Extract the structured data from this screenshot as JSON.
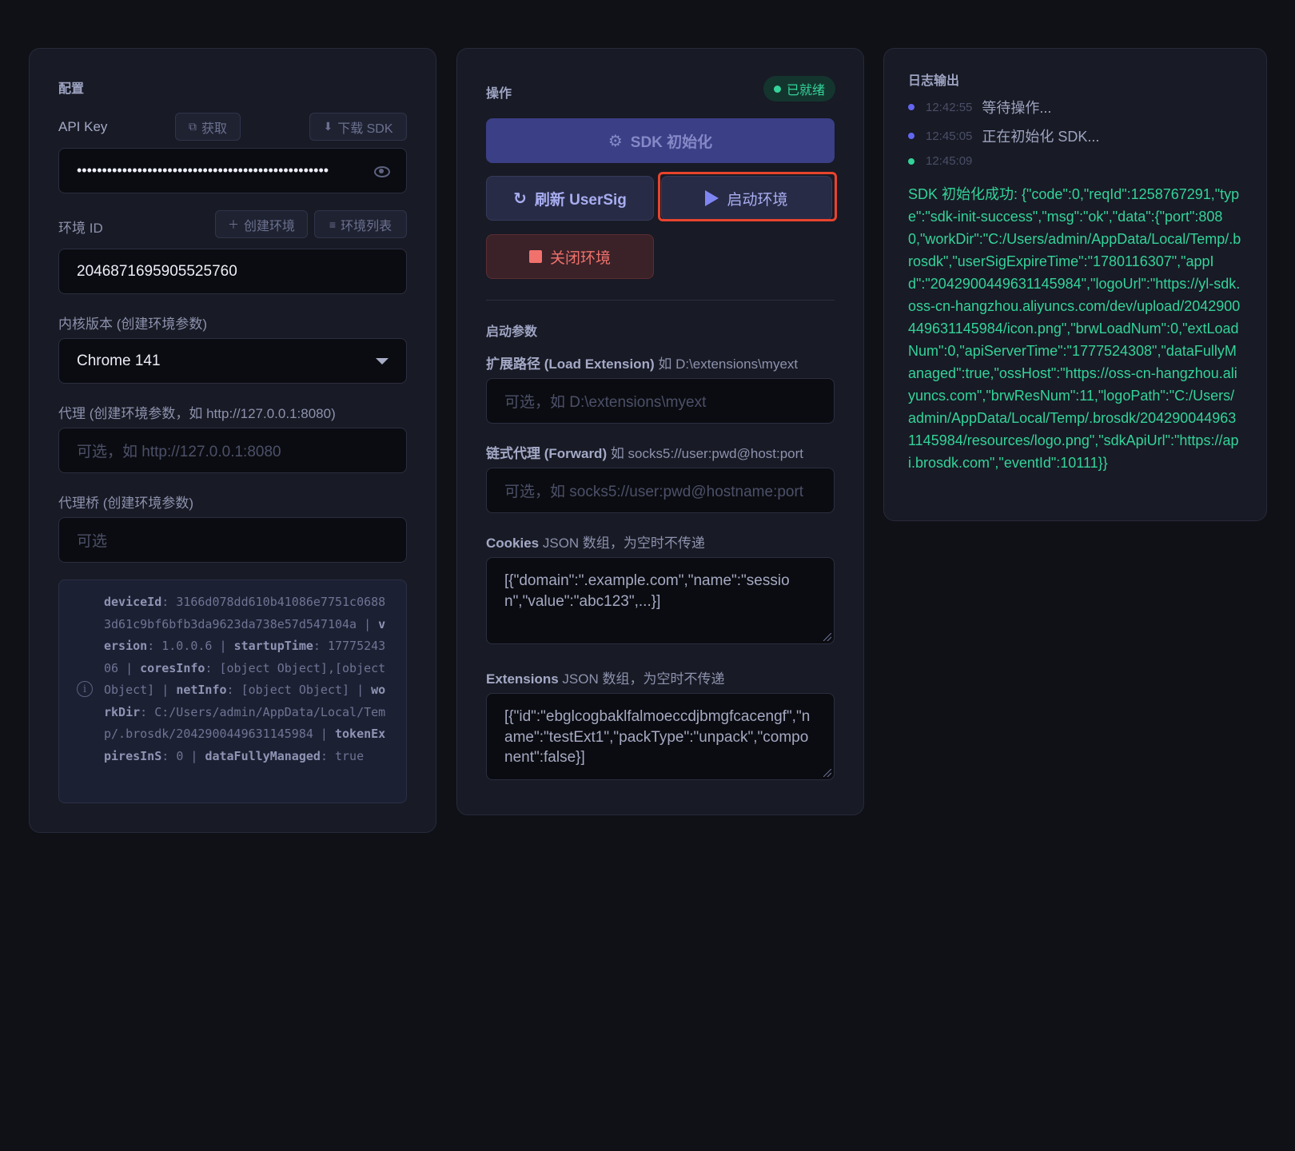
{
  "config": {
    "title": "配置",
    "api_key": {
      "label": "API Key",
      "get_button": "获取",
      "download_button": "下载 SDK",
      "value": "••••••••••••••••••••••••••••••••••••••••••••••••••"
    },
    "env_id": {
      "label": "环境 ID",
      "create_button": "创建环境",
      "list_button": "环境列表",
      "value": "2046871695905525760"
    },
    "kernel": {
      "label": "内核版本 (创建环境参数)",
      "value": "Chrome 141"
    },
    "proxy": {
      "label": "代理 (创建环境参数，如 http://127.0.0.1:8080)",
      "placeholder": "可选，如 http://127.0.0.1:8080"
    },
    "proxy_bridge": {
      "label": "代理桥 (创建环境参数)",
      "placeholder": "可选"
    },
    "info": [
      {
        "key": "deviceId",
        "value": "3166d078dd610b41086e7751c06883d61c9bf6bfb3da9623da738e57d547104a"
      },
      {
        "key": "version",
        "value": "1.0.0.6"
      },
      {
        "key": "startupTime",
        "value": "1777524306"
      },
      {
        "key": "coresInfo",
        "value": "[object Object],[object Object]"
      },
      {
        "key": "netInfo",
        "value": "[object Object]"
      },
      {
        "key": "workDir",
        "value": "C:/Users/admin/AppData/Local/Temp/.brosdk/2042900449631145984"
      },
      {
        "key": "tokenExpiresInS",
        "value": "0"
      },
      {
        "key": "dataFullyManaged",
        "value": "true"
      }
    ]
  },
  "actions": {
    "title": "操作",
    "status": "已就绪",
    "init_button": "SDK 初始化",
    "refresh_button": "刷新 UserSig",
    "start_button": "启动环境",
    "stop_button": "关闭环境",
    "params_title": "启动参数",
    "extension_path": {
      "label_bold": "扩展路径 (Load Extension)",
      "label_rest": " 如 D:\\extensions\\myext",
      "placeholder": "可选，如 D:\\extensions\\myext"
    },
    "forward_proxy": {
      "label_bold": "链式代理 (Forward)",
      "label_rest": " 如 socks5://user:pwd@host:port",
      "placeholder": "可选，如 socks5://user:pwd@hostname:port"
    },
    "cookies": {
      "label_bold": "Cookies",
      "label_rest": " JSON 数组，为空时不传递",
      "value": "[{\"domain\":\".example.com\",\"name\":\"session\",\"value\":\"abc123\",...}]"
    },
    "extensions": {
      "label_bold": "Extensions",
      "label_rest": " JSON 数组，为空时不传递",
      "value": "[{\"id\":\"ebglcogbaklfalmoeccdjbmgfcacengf\",\"name\":\"testExt1\",\"packType\":\"unpack\",\"component\":false}]"
    }
  },
  "log": {
    "title": "日志输出",
    "entries": [
      {
        "time": "12:42:55",
        "message": "等待操作...",
        "dot_color": "#6366f1"
      },
      {
        "time": "12:45:05",
        "message": "正在初始化 SDK...",
        "dot_color": "#6366f1"
      },
      {
        "time": "12:45:09",
        "message": "",
        "dot_color": "#34d399"
      }
    ],
    "success_message": "SDK 初始化成功: {\"code\":0,\"reqId\":1258767291,\"type\":\"sdk-init-success\",\"msg\":\"ok\",\"data\":{\"port\":8080,\"workDir\":\"C:/Users/admin/AppData/Local/Temp/.brosdk\",\"userSigExpireTime\":\"1780116307\",\"appId\":\"2042900449631145984\",\"logoUrl\":\"https://yl-sdk.oss-cn-hangzhou.aliyuncs.com/dev/upload/2042900449631145984/icon.png\",\"brwLoadNum\":0,\"extLoadNum\":0,\"apiServerTime\":\"1777524308\",\"dataFullyManaged\":true,\"ossHost\":\"https://oss-cn-hangzhou.aliyuncs.com\",\"brwResNum\":11,\"logoPath\":\"C:/Users/admin/AppData/Local/Temp/.brosdk/2042900449631145984/resources/logo.png\",\"sdkApiUrl\":\"https://api.brosdk.com\",\"eventId\":10111}}"
  }
}
